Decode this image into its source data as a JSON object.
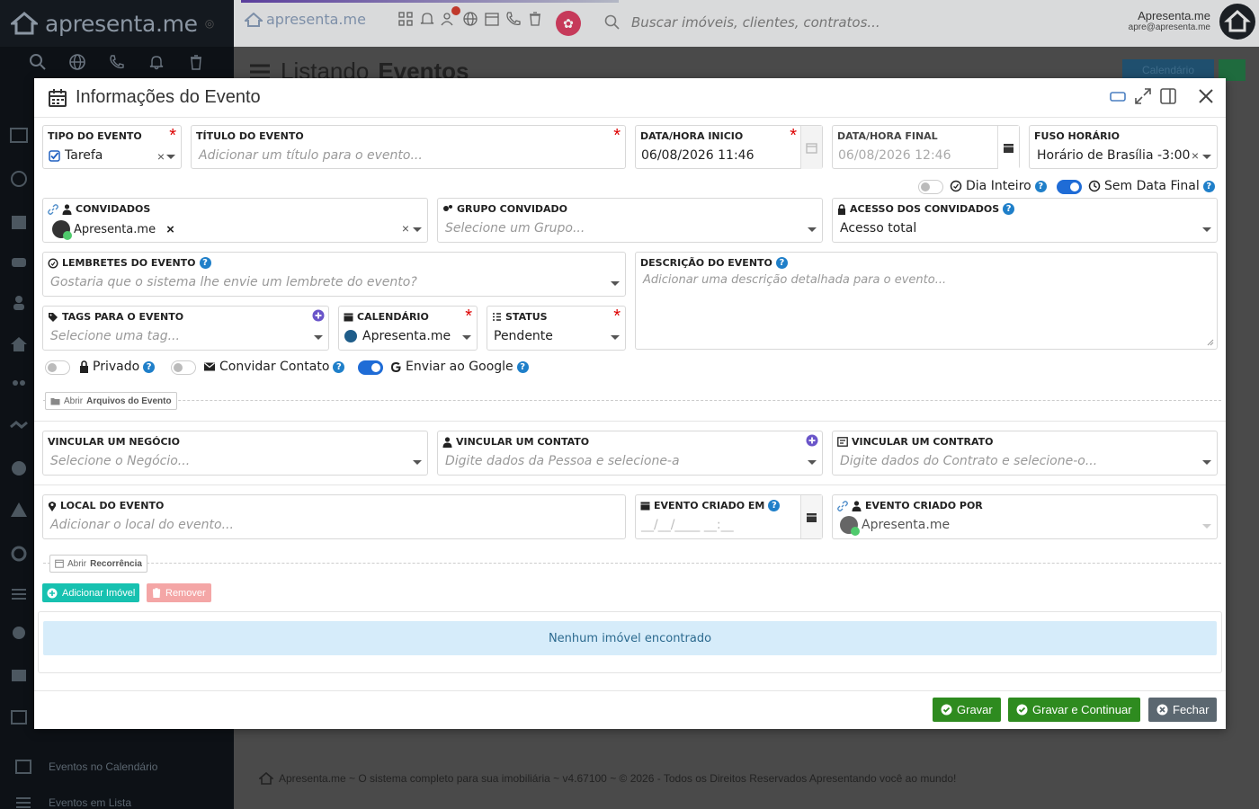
{
  "app": {
    "brand": "apresenta.me",
    "brand_small": "apresenta.me",
    "search_placeholder": "Buscar imóveis, clientes, contratos...",
    "user_name": "Apresenta.me",
    "user_email": "apre@apresenta.me",
    "page_title_prefix": "Listando",
    "page_title_bold": "Eventos",
    "calendar_button": "Calendário",
    "footer": "Apresenta.me ~ O sistema completo para sua imobiliária ~ v4.67100 ~ © 2026 - Todos os Direitos Reservados Apresentando você ao mundo!",
    "sidebar_items": [
      "Eventos no Calendário",
      "Eventos em Lista"
    ]
  },
  "modal": {
    "title": "Informações do Evento",
    "fields": {
      "tipo": {
        "label": "TIPO DO EVENTO",
        "value": "Tarefa"
      },
      "titulo": {
        "label": "TÍTULO DO EVENTO",
        "placeholder": "Adicionar um título para o evento..."
      },
      "data_inicio": {
        "label": "DATA/HORA INICIO",
        "value": "06/08/2026 11:46"
      },
      "data_final": {
        "label": "DATA/HORA FINAL",
        "value": "06/08/2026 12:46"
      },
      "fuso": {
        "label": "FUSO HORÁRIO",
        "value": "Horário de Brasília -3:00"
      },
      "convidados": {
        "label": "CONVIDADOS",
        "chip": "Apresenta.me"
      },
      "grupo": {
        "label": "GRUPO CONVIDADO",
        "placeholder": "Selecione um Grupo..."
      },
      "acesso": {
        "label": "ACESSO DOS CONVIDADOS",
        "value": "Acesso total"
      },
      "lembretes": {
        "label": "LEMBRETES DO EVENTO",
        "placeholder": "Gostaria que o sistema lhe envie um lembrete do evento?"
      },
      "descricao": {
        "label": "DESCRIÇÃO DO EVENTO",
        "placeholder": "Adicionar uma descrição detalhada para o evento..."
      },
      "tags": {
        "label": "TAGS PARA O EVENTO",
        "placeholder": "Selecione uma tag..."
      },
      "calendario": {
        "label": "CALENDÁRIO",
        "value": "Apresenta.me"
      },
      "status": {
        "label": "STATUS",
        "value": "Pendente"
      },
      "negocio": {
        "label": "VINCULAR UM NEGÓCIO",
        "placeholder": "Selecione o Negócio..."
      },
      "contato": {
        "label": "VINCULAR UM CONTATO",
        "placeholder": "Digite dados da Pessoa e selecione-a"
      },
      "contrato": {
        "label": "VINCULAR UM CONTRATO",
        "placeholder": "Digite dados do Contrato e selecione-o..."
      },
      "local": {
        "label": "LOCAL DO EVENTO",
        "placeholder": "Adicionar o local do evento..."
      },
      "criado_em": {
        "label": "EVENTO CRIADO EM",
        "placeholder": "__/__/____ __:__"
      },
      "criado_por": {
        "label": "EVENTO CRIADO POR",
        "value": "Apresenta.me"
      }
    },
    "toggles": {
      "dia_inteiro": {
        "label": "Dia Inteiro",
        "on": false
      },
      "sem_data_final": {
        "label": "Sem Data Final",
        "on": true
      },
      "privado": {
        "label": "Privado",
        "on": false
      },
      "convidar_contato": {
        "label": "Convidar Contato",
        "on": false
      },
      "enviar_google": {
        "label": "Enviar ao Google",
        "on": true
      }
    },
    "arquivos": {
      "prefix": "Abrir",
      "label": "Arquivos do Evento"
    },
    "recorrencia": {
      "prefix": "Abrir",
      "label": "Recorrência"
    },
    "add_imovel": "Adicionar Imóvel",
    "remover": "Remover",
    "empty_imovel": "Nenhum imóvel encontrado",
    "buttons": {
      "gravar": "Gravar",
      "gravar_continuar": "Gravar e Continuar",
      "fechar": "Fechar"
    },
    "colors": {
      "green": "#2e8b1f",
      "gray_btn": "#5b6770",
      "teal": "#17c1b0",
      "pink": "#f4a6a6",
      "info_bg": "#d6ecfa",
      "info_text": "#2c6a8f",
      "toggle_on": "#1f6cd6",
      "required": "#dd0000"
    }
  }
}
